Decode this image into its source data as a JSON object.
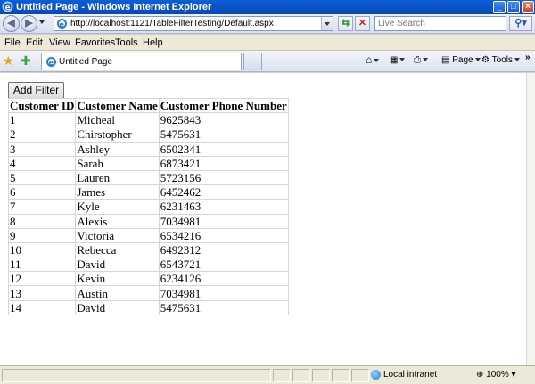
{
  "window": {
    "title": "Untitled Page - Windows Internet Explorer",
    "controls": {
      "minimize": "_",
      "maximize": "□",
      "close": "×"
    }
  },
  "address_bar": {
    "url": "http://localhost:1121/TableFilterTesting/Default.aspx",
    "search_placeholder": "Live Search"
  },
  "menu": {
    "items": [
      "File",
      "Edit",
      "View",
      "Favorites",
      "Tools",
      "Help"
    ]
  },
  "tab": {
    "label": "Untitled Page"
  },
  "command_bar": {
    "page_label": "Page",
    "tools_label": "Tools"
  },
  "content": {
    "add_filter_label": "Add Filter",
    "table": {
      "headers": [
        "Customer ID",
        "Customer Name",
        "Customer Phone Number"
      ],
      "rows": [
        [
          "1",
          "Micheal",
          "9625843"
        ],
        [
          "2",
          "Chirstopher",
          "5475631"
        ],
        [
          "3",
          "Ashley",
          "6502341"
        ],
        [
          "4",
          "Sarah",
          "6873421"
        ],
        [
          "5",
          "Lauren",
          "5723156"
        ],
        [
          "6",
          "James",
          "6452462"
        ],
        [
          "7",
          "Kyle",
          "6231463"
        ],
        [
          "8",
          "Alexis",
          "7034981"
        ],
        [
          "9",
          "Victoria",
          "6534216"
        ],
        [
          "10",
          "Rebecca",
          "6492312"
        ],
        [
          "11",
          "David",
          "6543721"
        ],
        [
          "12",
          "Kevin",
          "6234126"
        ],
        [
          "13",
          "Austin",
          "7034981"
        ],
        [
          "14",
          "David",
          "5475631"
        ]
      ]
    }
  },
  "status_bar": {
    "zone": "Local intranet",
    "zoom": "100%"
  },
  "icons": [
    "ie-logo-icon",
    "back-icon",
    "forward-icon",
    "refresh-icon",
    "stop-icon",
    "search-icon",
    "favorites-star-icon",
    "add-favorites-icon",
    "home-icon",
    "feeds-icon",
    "print-icon",
    "page-icon",
    "tools-icon",
    "globe-icon",
    "zoom-icon"
  ],
  "colors": {
    "titlebar": "#0b55cf",
    "chrome": "#ece9d8",
    "content": "#ffffff"
  }
}
